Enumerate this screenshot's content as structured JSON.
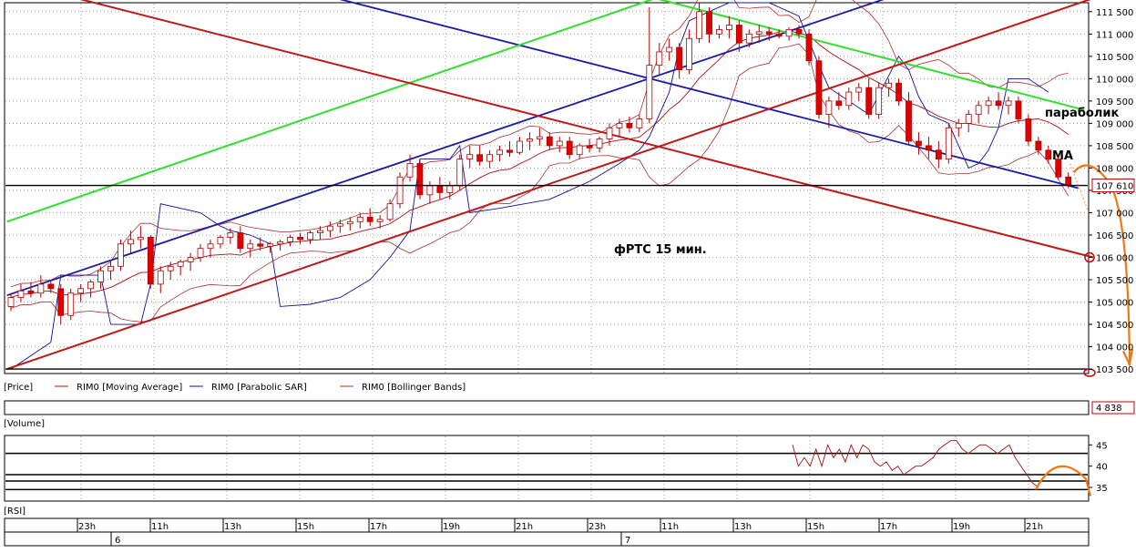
{
  "chart_data": {
    "type": "candlestick",
    "title": "фРТС   15 мин.",
    "price_axis": {
      "ylim": [
        103400,
        111700
      ],
      "ticks": [
        "111 500",
        "111 000",
        "110 500",
        "110 000",
        "109 500",
        "109 000",
        "108 500",
        "108 000",
        "107 500",
        "107 000",
        "106 500",
        "106 000",
        "105 500",
        "105 000",
        "104 500",
        "104 000",
        "103 500"
      ],
      "tick_values": [
        111500,
        111000,
        110500,
        110000,
        109500,
        109000,
        108500,
        108000,
        107500,
        107000,
        106500,
        106000,
        105500,
        105000,
        104500,
        104000,
        103500
      ],
      "last_price_label": "107 610",
      "last_price": 107610
    },
    "time_axis": {
      "hour_labels": [
        "23h",
        "11h",
        "13h",
        "15h",
        "17h",
        "19h",
        "21h",
        "23h",
        "11h",
        "13h",
        "15h",
        "17h",
        "19h",
        "21h"
      ],
      "day_labels": [
        "6",
        "7"
      ]
    },
    "legend": [
      "[Price]",
      "RIM0 [Moving Average]",
      "RIM0 [Parabolic SAR]",
      "RIM0 [Bollinger Bands]"
    ],
    "candles": [
      [
        104900,
        105200,
        104800,
        105100
      ],
      [
        105100,
        105400,
        105000,
        105250
      ],
      [
        105250,
        105450,
        105100,
        105200
      ],
      [
        105200,
        105600,
        105100,
        105400
      ],
      [
        105400,
        105500,
        105200,
        105300
      ],
      [
        105300,
        105400,
        104500,
        104700
      ],
      [
        104700,
        105300,
        104600,
        105200
      ],
      [
        105200,
        105400,
        105000,
        105300
      ],
      [
        105300,
        105500,
        105100,
        105450
      ],
      [
        105450,
        105800,
        105300,
        105700
      ],
      [
        105700,
        105900,
        105500,
        105800
      ],
      [
        105800,
        106400,
        105700,
        106300
      ],
      [
        106300,
        106600,
        106100,
        106400
      ],
      [
        106400,
        106700,
        106200,
        106450
      ],
      [
        106450,
        106500,
        105300,
        105400
      ],
      [
        105400,
        105800,
        105200,
        105700
      ],
      [
        105700,
        105900,
        105500,
        105800
      ],
      [
        105800,
        105950,
        105600,
        105900
      ],
      [
        105900,
        106100,
        105700,
        106000
      ],
      [
        106000,
        106300,
        105900,
        106200
      ],
      [
        106200,
        106400,
        106000,
        106300
      ],
      [
        106300,
        106500,
        106200,
        106450
      ],
      [
        106450,
        106650,
        106300,
        106550
      ],
      [
        106550,
        106700,
        106100,
        106200
      ],
      [
        106200,
        106400,
        106000,
        106300
      ],
      [
        106300,
        106450,
        106150,
        106250
      ],
      [
        106250,
        106350,
        106100,
        106300
      ],
      [
        106300,
        106400,
        106150,
        106350
      ],
      [
        106350,
        106500,
        106250,
        106450
      ],
      [
        106450,
        106550,
        106300,
        106400
      ],
      [
        106400,
        106600,
        106300,
        106550
      ],
      [
        106550,
        106700,
        106400,
        106600
      ],
      [
        106600,
        106800,
        106450,
        106700
      ],
      [
        106700,
        106850,
        106550,
        106750
      ],
      [
        106750,
        106900,
        106600,
        106800
      ],
      [
        106800,
        107000,
        106650,
        106900
      ],
      [
        106900,
        107100,
        106700,
        106800
      ],
      [
        106800,
        106950,
        106650,
        106850
      ],
      [
        106850,
        107300,
        106800,
        107200
      ],
      [
        107200,
        107900,
        107100,
        107800
      ],
      [
        107800,
        108300,
        107700,
        108100
      ],
      [
        108100,
        108200,
        107300,
        107400
      ],
      [
        107400,
        107700,
        107200,
        107600
      ],
      [
        107600,
        107800,
        107300,
        107450
      ],
      [
        107450,
        107700,
        107300,
        107600
      ],
      [
        107600,
        108300,
        107500,
        108200
      ],
      [
        108200,
        108500,
        108000,
        108300
      ],
      [
        108300,
        108500,
        108050,
        108150
      ],
      [
        108150,
        108400,
        108000,
        108300
      ],
      [
        108300,
        108500,
        108150,
        108400
      ],
      [
        108400,
        108600,
        108250,
        108350
      ],
      [
        108350,
        108700,
        108300,
        108600
      ],
      [
        108600,
        108800,
        108400,
        108650
      ],
      [
        108650,
        108900,
        108500,
        108700
      ],
      [
        108700,
        108800,
        108400,
        108500
      ],
      [
        108500,
        108700,
        108350,
        108600
      ],
      [
        108600,
        108700,
        108200,
        108300
      ],
      [
        108300,
        108550,
        108200,
        108500
      ],
      [
        108500,
        108650,
        108350,
        108450
      ],
      [
        108450,
        108700,
        108350,
        108650
      ],
      [
        108650,
        109000,
        108500,
        108900
      ],
      [
        108900,
        109100,
        108700,
        109000
      ],
      [
        109000,
        109150,
        108800,
        108900
      ],
      [
        108900,
        109200,
        108800,
        109100
      ],
      [
        109100,
        111600,
        109000,
        110300
      ],
      [
        110300,
        110800,
        110100,
        110600
      ],
      [
        110600,
        110900,
        110400,
        110700
      ],
      [
        110700,
        110800,
        110000,
        110200
      ],
      [
        110200,
        111100,
        110100,
        110900
      ],
      [
        110900,
        111700,
        110800,
        111500
      ],
      [
        111500,
        111600,
        110800,
        111000
      ],
      [
        111000,
        111200,
        110900,
        111100
      ],
      [
        111100,
        111400,
        110900,
        111200
      ],
      [
        111200,
        111300,
        110600,
        110800
      ],
      [
        110800,
        111100,
        110700,
        111000
      ],
      [
        111000,
        111200,
        110800,
        111050
      ],
      [
        111050,
        111150,
        110850,
        111000
      ],
      [
        111000,
        111100,
        110900,
        110950
      ],
      [
        110950,
        111150,
        110850,
        111100
      ],
      [
        111100,
        111200,
        110900,
        111000
      ],
      [
        111000,
        111100,
        110300,
        110400
      ],
      [
        110400,
        110500,
        109100,
        109200
      ],
      [
        109200,
        109600,
        108900,
        109500
      ],
      [
        109500,
        109700,
        109300,
        109400
      ],
      [
        109400,
        109800,
        109300,
        109700
      ],
      [
        109700,
        109900,
        109500,
        109800
      ],
      [
        109800,
        110000,
        109100,
        109200
      ],
      [
        109200,
        109900,
        109100,
        109800
      ],
      [
        109800,
        110000,
        109600,
        109900
      ],
      [
        109900,
        110000,
        109400,
        109500
      ],
      [
        109500,
        109700,
        108500,
        108600
      ],
      [
        108600,
        108800,
        108300,
        108500
      ],
      [
        108500,
        108700,
        108200,
        108400
      ],
      [
        108400,
        108600,
        108000,
        108200
      ],
      [
        108200,
        109000,
        108100,
        108900
      ],
      [
        108900,
        109100,
        108700,
        109000
      ],
      [
        109000,
        109300,
        108800,
        109200
      ],
      [
        109200,
        109500,
        109000,
        109400
      ],
      [
        109400,
        109600,
        109200,
        109500
      ],
      [
        109500,
        109700,
        109300,
        109400
      ],
      [
        109400,
        109600,
        109200,
        109500
      ],
      [
        109500,
        109600,
        109000,
        109100
      ],
      [
        109100,
        109200,
        108500,
        108600
      ],
      [
        108600,
        108700,
        108300,
        108400
      ],
      [
        108400,
        108500,
        108100,
        108200
      ],
      [
        108200,
        108300,
        107750,
        107800
      ],
      [
        107800,
        107900,
        107550,
        107610
      ]
    ],
    "sar": [
      [
        0,
        103500
      ],
      [
        4,
        104100
      ],
      [
        5,
        105600
      ],
      [
        9,
        105600
      ],
      [
        10,
        104500
      ],
      [
        13,
        104500
      ],
      [
        14,
        105400
      ],
      [
        15,
        107200
      ],
      [
        19,
        107000
      ],
      [
        21,
        106700
      ],
      [
        22,
        106600
      ],
      [
        24,
        106500
      ],
      [
        26,
        106300
      ],
      [
        27,
        104900
      ],
      [
        30,
        104950
      ],
      [
        33,
        105100
      ],
      [
        36,
        105500
      ],
      [
        38,
        106000
      ],
      [
        40,
        106600
      ],
      [
        41,
        108200
      ],
      [
        44,
        108200
      ],
      [
        45,
        108500
      ],
      [
        46,
        107000
      ],
      [
        49,
        107100
      ],
      [
        54,
        107300
      ],
      [
        58,
        107700
      ],
      [
        61,
        108100
      ],
      [
        63,
        108400
      ],
      [
        64,
        108700
      ],
      [
        65,
        109200
      ],
      [
        66,
        109700
      ],
      [
        67,
        110700
      ],
      [
        68,
        111300
      ],
      [
        70,
        111500
      ],
      [
        72,
        111700
      ],
      [
        73,
        111900
      ],
      [
        76,
        111700
      ],
      [
        79,
        111400
      ],
      [
        81,
        110300
      ],
      [
        82,
        109800
      ],
      [
        84,
        109500
      ],
      [
        86,
        109200
      ],
      [
        89,
        110500
      ],
      [
        90,
        110200
      ],
      [
        91,
        109600
      ],
      [
        92,
        109200
      ],
      [
        94,
        109000
      ],
      [
        95,
        108500
      ],
      [
        96,
        108000
      ],
      [
        97,
        108100
      ],
      [
        98,
        108400
      ],
      [
        99,
        108900
      ],
      [
        100,
        110000
      ],
      [
        102,
        110000
      ],
      [
        104,
        109700
      ]
    ],
    "hlines": [
      107610,
      103500
    ],
    "oscillator": {
      "name": "[RSI]",
      "ylim": [
        32,
        47
      ],
      "ticks": [
        "45",
        "40",
        "35"
      ],
      "tick_values": [
        45,
        40,
        35
      ],
      "hlines": [
        43,
        38,
        36.5,
        34.5
      ],
      "values": [
        [
          82,
          45
        ],
        [
          83,
          40
        ],
        [
          84,
          42
        ],
        [
          85,
          40
        ],
        [
          86,
          44
        ],
        [
          87,
          40
        ],
        [
          88,
          45
        ],
        [
          89,
          42
        ],
        [
          90,
          44
        ],
        [
          91,
          41
        ],
        [
          92,
          45
        ],
        [
          93,
          42
        ],
        [
          94,
          45
        ],
        [
          95,
          44
        ],
        [
          96,
          41
        ],
        [
          97,
          40
        ],
        [
          98,
          41
        ],
        [
          99,
          39
        ],
        [
          100,
          40
        ],
        [
          101,
          38
        ],
        [
          102,
          39
        ],
        [
          103,
          40
        ],
        [
          104,
          40
        ],
        [
          105,
          41
        ],
        [
          106,
          42
        ],
        [
          107,
          44
        ],
        [
          108,
          45
        ],
        [
          109,
          46
        ],
        [
          110,
          46
        ],
        [
          111,
          44
        ],
        [
          112,
          43
        ],
        [
          113,
          44
        ],
        [
          114,
          45
        ],
        [
          115,
          45
        ],
        [
          116,
          44
        ],
        [
          117,
          43
        ],
        [
          118,
          44
        ],
        [
          119,
          45
        ],
        [
          120,
          42
        ],
        [
          121,
          40
        ],
        [
          122,
          38
        ],
        [
          123,
          36
        ],
        [
          124,
          35
        ]
      ]
    },
    "volume": {
      "label": "[Volume]",
      "value_label": "4 838"
    },
    "annotations": {
      "parabolic_label": "параболик",
      "ma_label": "MA"
    },
    "colors": {
      "candle_up": "#ffffff",
      "candle_down": "#e00000",
      "candle_outline": "#b00000",
      "moving_average": "#b01010",
      "parabolic_sar": "#10109a",
      "bollinger": "#b03030",
      "trend_blue": "#1a1aa8",
      "trend_green": "#30e030",
      "trend_red": "#c01818",
      "forecast": "#f07810",
      "grid": "#a0a0a0"
    }
  }
}
